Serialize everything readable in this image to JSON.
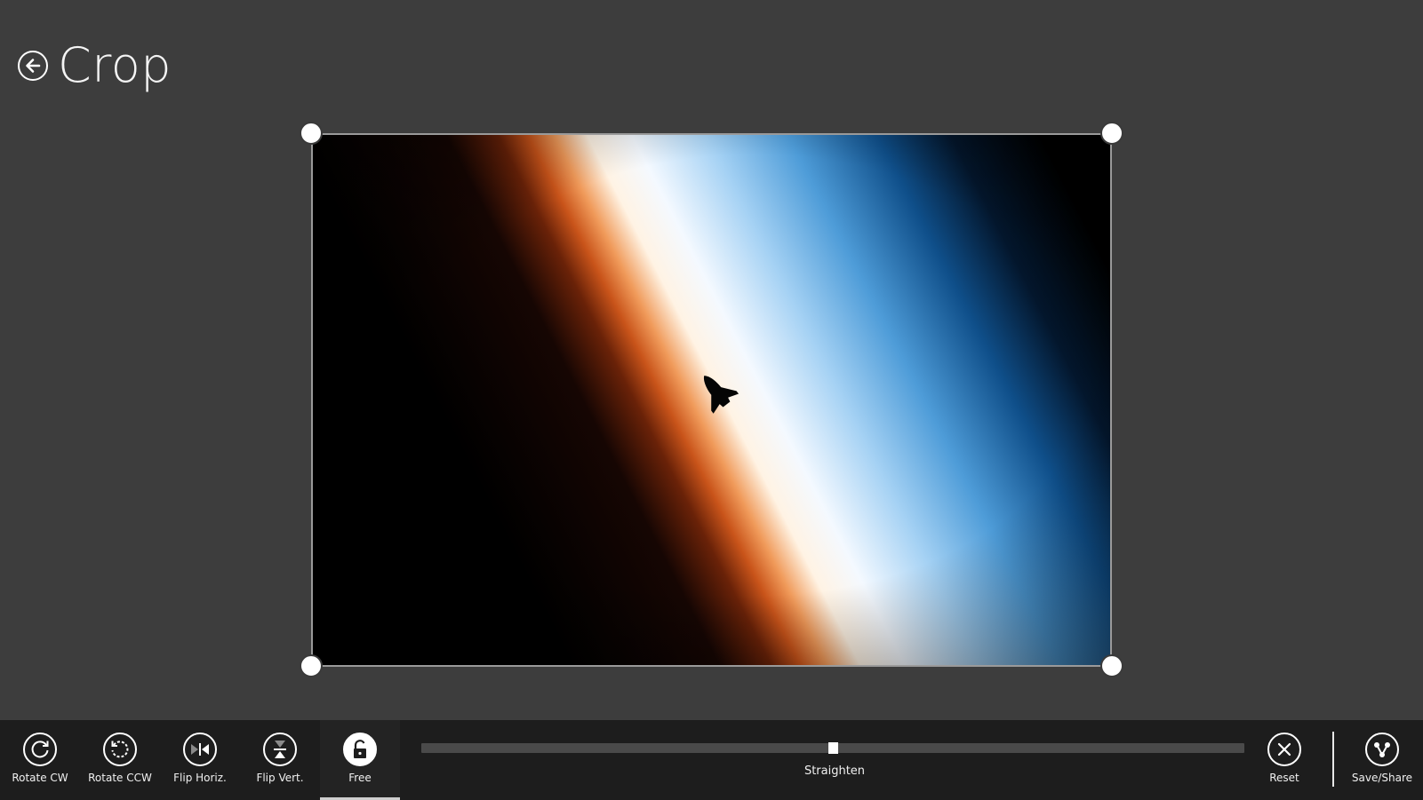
{
  "header": {
    "title": "Crop"
  },
  "toolbar": {
    "tools": [
      {
        "label": "Rotate CW",
        "icon": "rotate-cw-icon"
      },
      {
        "label": "Rotate CCW",
        "icon": "rotate-ccw-icon"
      },
      {
        "label": "Flip Horiz.",
        "icon": "flip-horizontal-icon"
      },
      {
        "label": "Flip Vert.",
        "icon": "flip-vertical-icon"
      },
      {
        "label": "Free",
        "icon": "unlock-icon",
        "active": true
      }
    ],
    "straighten": {
      "label": "Straighten",
      "value_fraction": 0.5
    },
    "reset": {
      "label": "Reset",
      "icon": "close-icon"
    },
    "save_share": {
      "label": "Save/Share",
      "icon": "share-icon"
    }
  },
  "colors": {
    "background": "#3d3d3d",
    "appbar": "#1d1d1d",
    "accent": "#ffffff"
  }
}
